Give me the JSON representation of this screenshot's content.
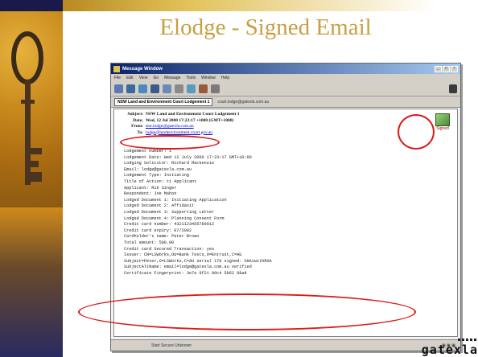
{
  "slide": {
    "title": "Elodge - Signed Email",
    "footer_brand": "gatexla",
    "accent_color": "#c8a042",
    "annotation_color": "#dd1a1a"
  },
  "window": {
    "title": "Message Window",
    "menu": [
      "File",
      "Edit",
      "View",
      "Go",
      "Message",
      "Tools",
      "Window",
      "Help"
    ],
    "tab_label": "NSW Land and Environment Court Lodgement 1",
    "tab_address": "court.lodge@gatexla.com.au",
    "status_text": "Start Secure Unknown"
  },
  "email": {
    "subject_label": "Subject:",
    "subject": "NSW Land and Environment Court Lodgement 1",
    "date_label": "Date:",
    "date": "Wed, 12 Jul 2000 17:23:17 +1000 (GMT+1000)",
    "from_label": "From:",
    "from": "test.lodge@gatexla.com.au",
    "to_label": "To:",
    "to": "lodge@landenvironment.court.gov.au",
    "signed_icon_label": "Signed",
    "body_lines": [
      "Lodgement number: 1",
      "Lodgement Date: Wed 12 July 2000 17:23:17 GMT+10:00",
      "Lodging Solicitor: Richard Mackenzie",
      "Email: lodge@gatexla.com.au",
      "Lodgement Type: Initiating",
      "Title of Action: ti Applicant",
      "Applicant: Rik Singer",
      "Respondent: Joe Mahon",
      "Lodged Document 1: Initiating Application",
      "Lodged Document 2: Affidavit",
      "Lodged Document 3: Supporting Letter",
      "Lodged Document 4: Planning Consent Form",
      "Credit card number: 4321123456789012",
      "Credit card expiry: 07/2002",
      "Cardholder's name: Peter Brown",
      "Total amount: 500.00",
      "Credit card Secured Transaction: yes",
      "Issuer: CN=LSWorks,OU=Bank Tests,O=Entrust,C=AU",
      "Subject=Peter,O=LSWorks,C=AU serial 178 signed: SHA1withRSA",
      "SubjectAltName: email=lodge@gatexla.com.au verified",
      "Certificate Fingerprint: 3e7a 9f21 00c4 5b62 88ad"
    ]
  }
}
